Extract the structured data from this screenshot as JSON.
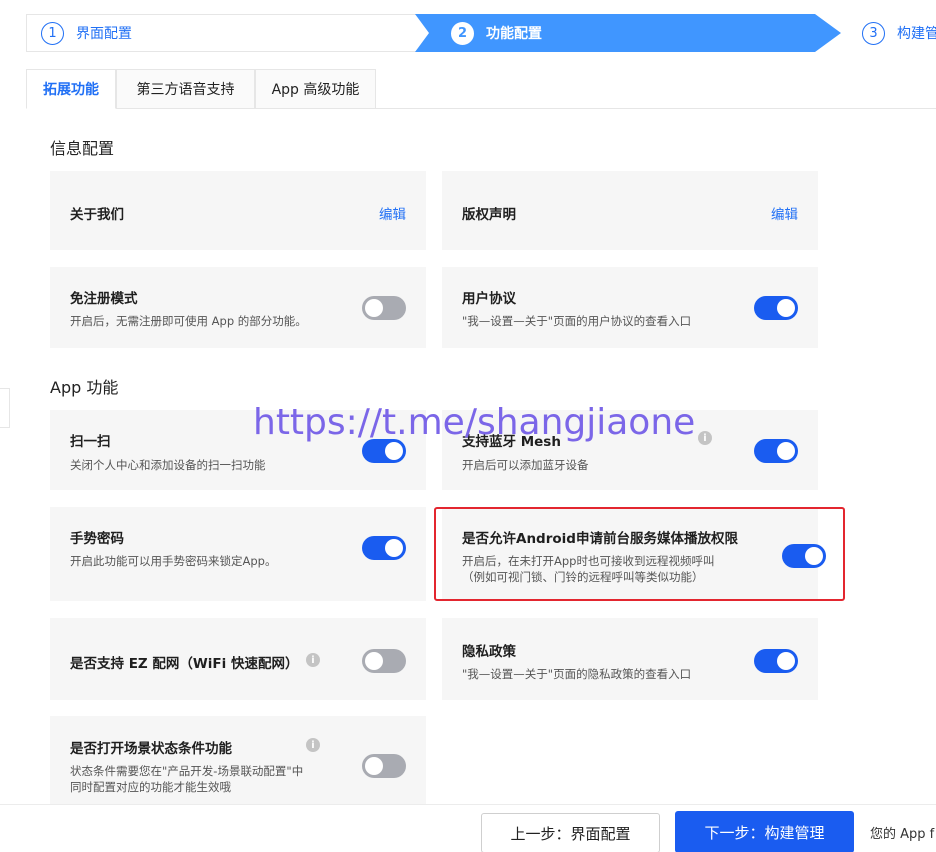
{
  "stepper": {
    "steps": [
      {
        "num": "1",
        "label": "界面配置"
      },
      {
        "num": "2",
        "label": "功能配置"
      },
      {
        "num": "3",
        "label": "构建管"
      }
    ]
  },
  "tabs": [
    "拓展功能",
    "第三方语音支持",
    "App 高级功能"
  ],
  "sections": {
    "info_title": "信息配置",
    "app_title": "App 功能"
  },
  "cards": {
    "about": {
      "title": "关于我们",
      "edit": "编辑"
    },
    "copyright": {
      "title": "版权声明",
      "edit": "编辑"
    },
    "no_register": {
      "title": "免注册模式",
      "desc": "开启后，无需注册即可使用 App 的部分功能。",
      "on": false
    },
    "user_agreement": {
      "title": "用户协议",
      "desc": "\"我—设置—关于\"页面的用户协议的查看入口",
      "on": true
    },
    "scan": {
      "title": "扫一扫",
      "desc": "关闭个人中心和添加设备的扫一扫功能",
      "on": true
    },
    "bluetooth_mesh": {
      "title": "支持蓝牙 Mesh",
      "desc": "开启后可以添加蓝牙设备",
      "on": true
    },
    "gesture": {
      "title": "手势密码",
      "desc": "开启此功能可以用手势密码来锁定App。",
      "on": true
    },
    "android_media": {
      "title": "是否允许Android申请前台服务媒体播放权限",
      "desc1": "开启后，在未打开App时也可接收到远程视频呼叫",
      "desc2": "（例如可视门锁、门铃的远程呼叫等类似功能）",
      "on": true
    },
    "ez_network": {
      "title": "是否支持 EZ 配网（WiFi 快速配网）",
      "on": false
    },
    "privacy": {
      "title": "隐私政策",
      "desc": "\"我—设置—关于\"页面的隐私政策的查看入口",
      "on": true
    },
    "scene_condition": {
      "title": "是否打开场景状态条件功能",
      "desc1": "状态条件需要您在\"产品开发-场景联动配置\"中",
      "desc2": "同时配置对应的功能才能生效哦",
      "on": false
    }
  },
  "overlay_link": "https://t.me/shangjiaone",
  "footer": {
    "prev": "上一步：界面配置",
    "next": "下一步：构建管理",
    "note": "您的 App f"
  },
  "colors": {
    "accent": "#1a5cf0",
    "step_active": "#4096ff",
    "highlight": "#e3262f"
  },
  "icons": {
    "info": "info-circle-icon"
  }
}
